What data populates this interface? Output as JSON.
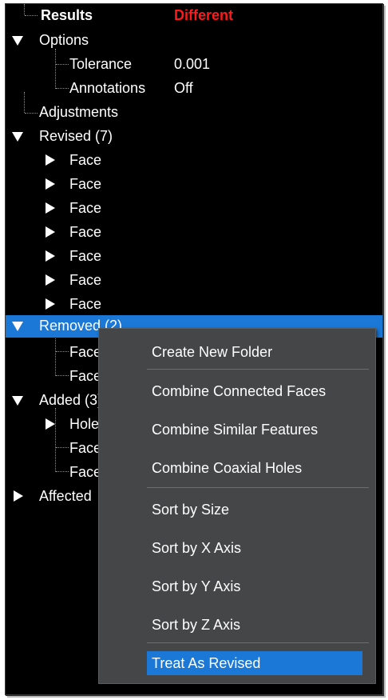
{
  "tree": {
    "results": {
      "label": "Results",
      "value": "Different"
    },
    "options": {
      "label": "Options"
    },
    "tolerance": {
      "label": "Tolerance",
      "value": "0.001"
    },
    "annotations": {
      "label": "Annotations",
      "value": "Off"
    },
    "adjustments": {
      "label": "Adjustments"
    },
    "revised": {
      "label": "Revised (7)",
      "children": [
        "Face",
        "Face",
        "Face",
        "Face",
        "Face",
        "Face",
        "Face"
      ]
    },
    "removed": {
      "label": "Removed (2)",
      "children": [
        "Face",
        "Face"
      ]
    },
    "added": {
      "label": "Added (3)",
      "children": [
        "Hole",
        "Face",
        "Face"
      ]
    },
    "affected": {
      "label": "Affected"
    }
  },
  "context_menu": {
    "items": [
      "Create New Folder",
      "Combine Connected Faces",
      "Combine Similar Features",
      "Combine Coaxial Holes",
      "Sort by Size",
      "Sort by X Axis",
      "Sort by Y Axis",
      "Sort by Z Axis",
      "Treat As Revised"
    ]
  },
  "colors": {
    "background": "#000000",
    "text": "#ffffff",
    "different": "#ff1a1a",
    "selection": "#1b78d6",
    "menu_bg": "#444648"
  }
}
